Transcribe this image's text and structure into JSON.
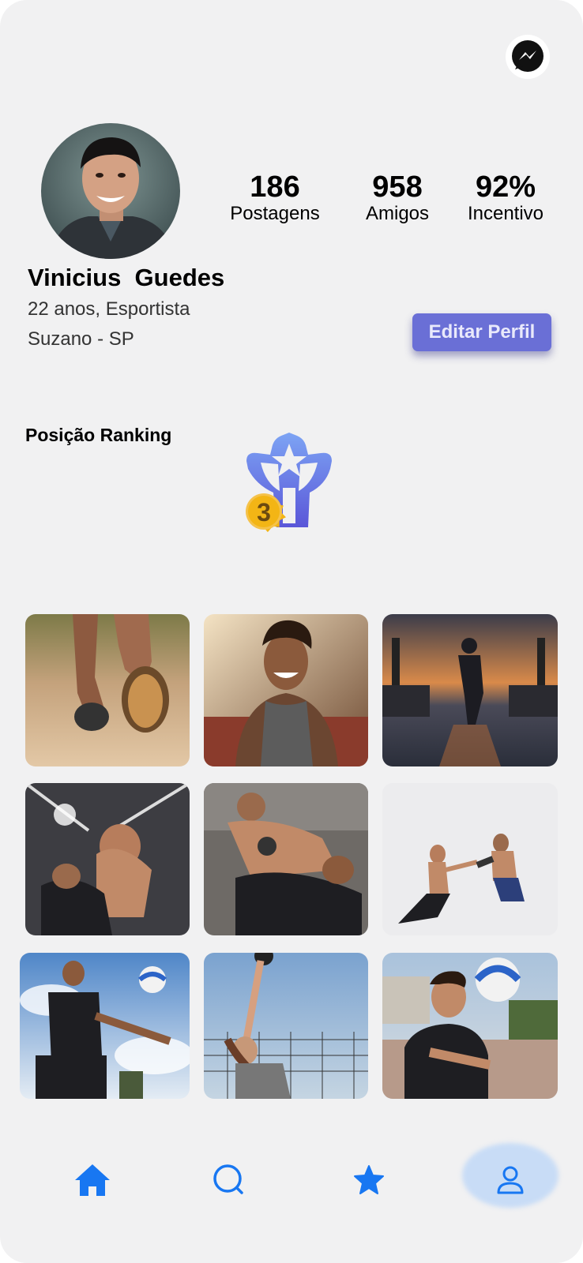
{
  "profile": {
    "name": "Vinicius  Guedes",
    "age_sport": "22 anos, Esportista",
    "location": "Suzano - SP",
    "edit_button": "Editar Perfil"
  },
  "stats": [
    {
      "value": "186",
      "label": "Postagens"
    },
    {
      "value": "958",
      "label": "Amigos"
    },
    {
      "value": "92%",
      "label": "Incentivo"
    }
  ],
  "ranking": {
    "title": "Posição Ranking",
    "position": "3"
  },
  "nav": {
    "items": [
      "home-icon",
      "search-icon",
      "star-icon",
      "user-icon"
    ],
    "active": "user-icon"
  },
  "colors": {
    "accent": "#1877f2",
    "edit_button": "#6a6fd6",
    "trophy": "#6f79e6",
    "medal": "#f3b515"
  }
}
